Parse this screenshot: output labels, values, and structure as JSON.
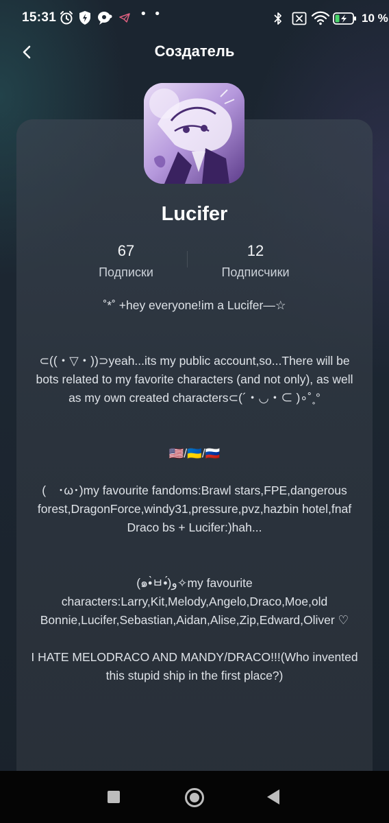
{
  "status_bar": {
    "time": "15:31",
    "dots": "• •",
    "battery_percent": "10 %",
    "left_icons": [
      "alarm-icon",
      "shield-bolt-icon",
      "chat-bubble-icon",
      "telegram-icon"
    ],
    "right_icons": [
      "bluetooth-icon",
      "no-sim-icon",
      "wifi-icon",
      "battery-charging-icon"
    ]
  },
  "header": {
    "title": "Создатель",
    "back_icon": "chevron-left-icon"
  },
  "profile": {
    "username": "Lucifer",
    "following_count": "67",
    "following_label": "Подписки",
    "followers_count": "12",
    "followers_label": "Подписчики"
  },
  "bio": {
    "line_1": "˚*˚ +hey everyone!im a Lucifer—☆",
    "paragraph_2": "⊂((・▽・))⊃yeah...its my public account,so...There will be bots related to my favorite characters (and not only), as well as my own created characters⊂(´・◡・⊂ )∘˚˳°",
    "flags": "🇺🇸/🇺🇦/🇷🇺",
    "paragraph_4_line_1": "(　･ω･)my favourite fandoms:Brawl stars,FPE,dangerous forest,DragonForce,windy31,pressure,pvz,hazbin hotel,fnaf",
    "paragraph_4_line_2": "Draco bs + Lucifer:)hah...",
    "paragraph_5": "(๑•̀ㅂ•́)و✧my favourite characters:Larry,Kit,Melody,Angelo,Draco,Moe,old Bonnie,Lucifer,Sebastian,Aidan,Alise,Zip,Edward,Oliver ♡",
    "paragraph_6": "I HATE MELODRACO AND MANDY/DRACO!!!(Who invented this stupid ship in the first place?)"
  },
  "nav_bar": {
    "icons": [
      "recent-apps-icon",
      "home-icon",
      "back-triangle-icon"
    ]
  },
  "colors": {
    "background": "#1b2530",
    "card": "#343d48",
    "text_primary": "#ffffff",
    "text_secondary": "#cbd1d8",
    "avatar_accent": "#a986d4"
  }
}
